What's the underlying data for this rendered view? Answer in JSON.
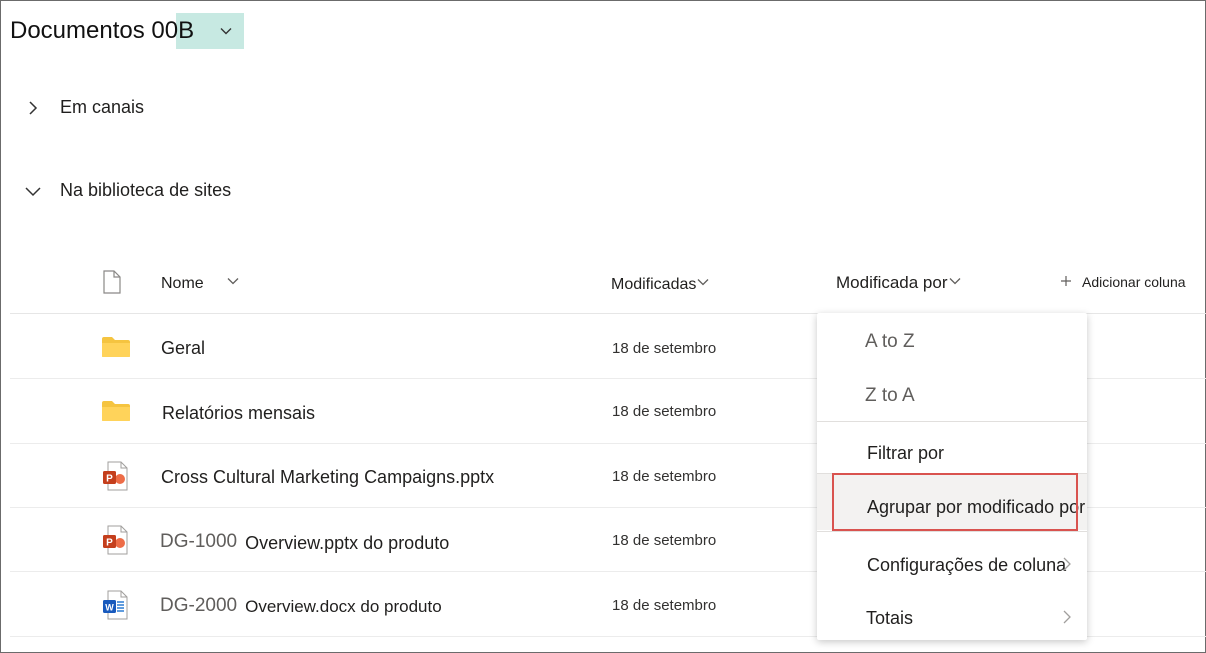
{
  "library": {
    "title": "Documentos 00B"
  },
  "sections": [
    {
      "label": "Em canais",
      "expanded": false
    },
    {
      "label": "Na biblioteca de sites",
      "expanded": true
    }
  ],
  "columns": {
    "name": "Nome",
    "modified": "Modificadas",
    "modified_by": "Modificada por",
    "add_column": "Adicionar coluna"
  },
  "rows": [
    {
      "icon": "folder-icon",
      "prefix": "",
      "name": "Geral",
      "modified": "18 de setembro"
    },
    {
      "icon": "folder-icon",
      "prefix": "",
      "name": "Relatórios mensais",
      "modified": "18 de setembro"
    },
    {
      "icon": "powerpoint-file-icon",
      "prefix": "",
      "name": "Cross Cultural Marketing Campaigns.pptx",
      "modified": "18 de setembro"
    },
    {
      "icon": "powerpoint-file-icon",
      "prefix": "DG-1000",
      "name": "Overview.pptx do produto",
      "modified": "18 de setembro"
    },
    {
      "icon": "word-file-icon",
      "prefix": "DG-2000",
      "name": "Overview.docx do produto",
      "modified": "18 de setembro"
    }
  ],
  "menu": {
    "sort_asc": "A to Z",
    "sort_desc": "Z to A",
    "filter_by": "Filtrar por",
    "group_by": "Agrupar por modificado por",
    "column_settings": "Configurações de coluna",
    "totals": "Totais"
  },
  "colors": {
    "title_highlight": "#c7e9e2",
    "folder": "#f5c440",
    "powerpoint": "#c43e1c",
    "word": "#185abd",
    "highlight_border": "#d9534f"
  }
}
